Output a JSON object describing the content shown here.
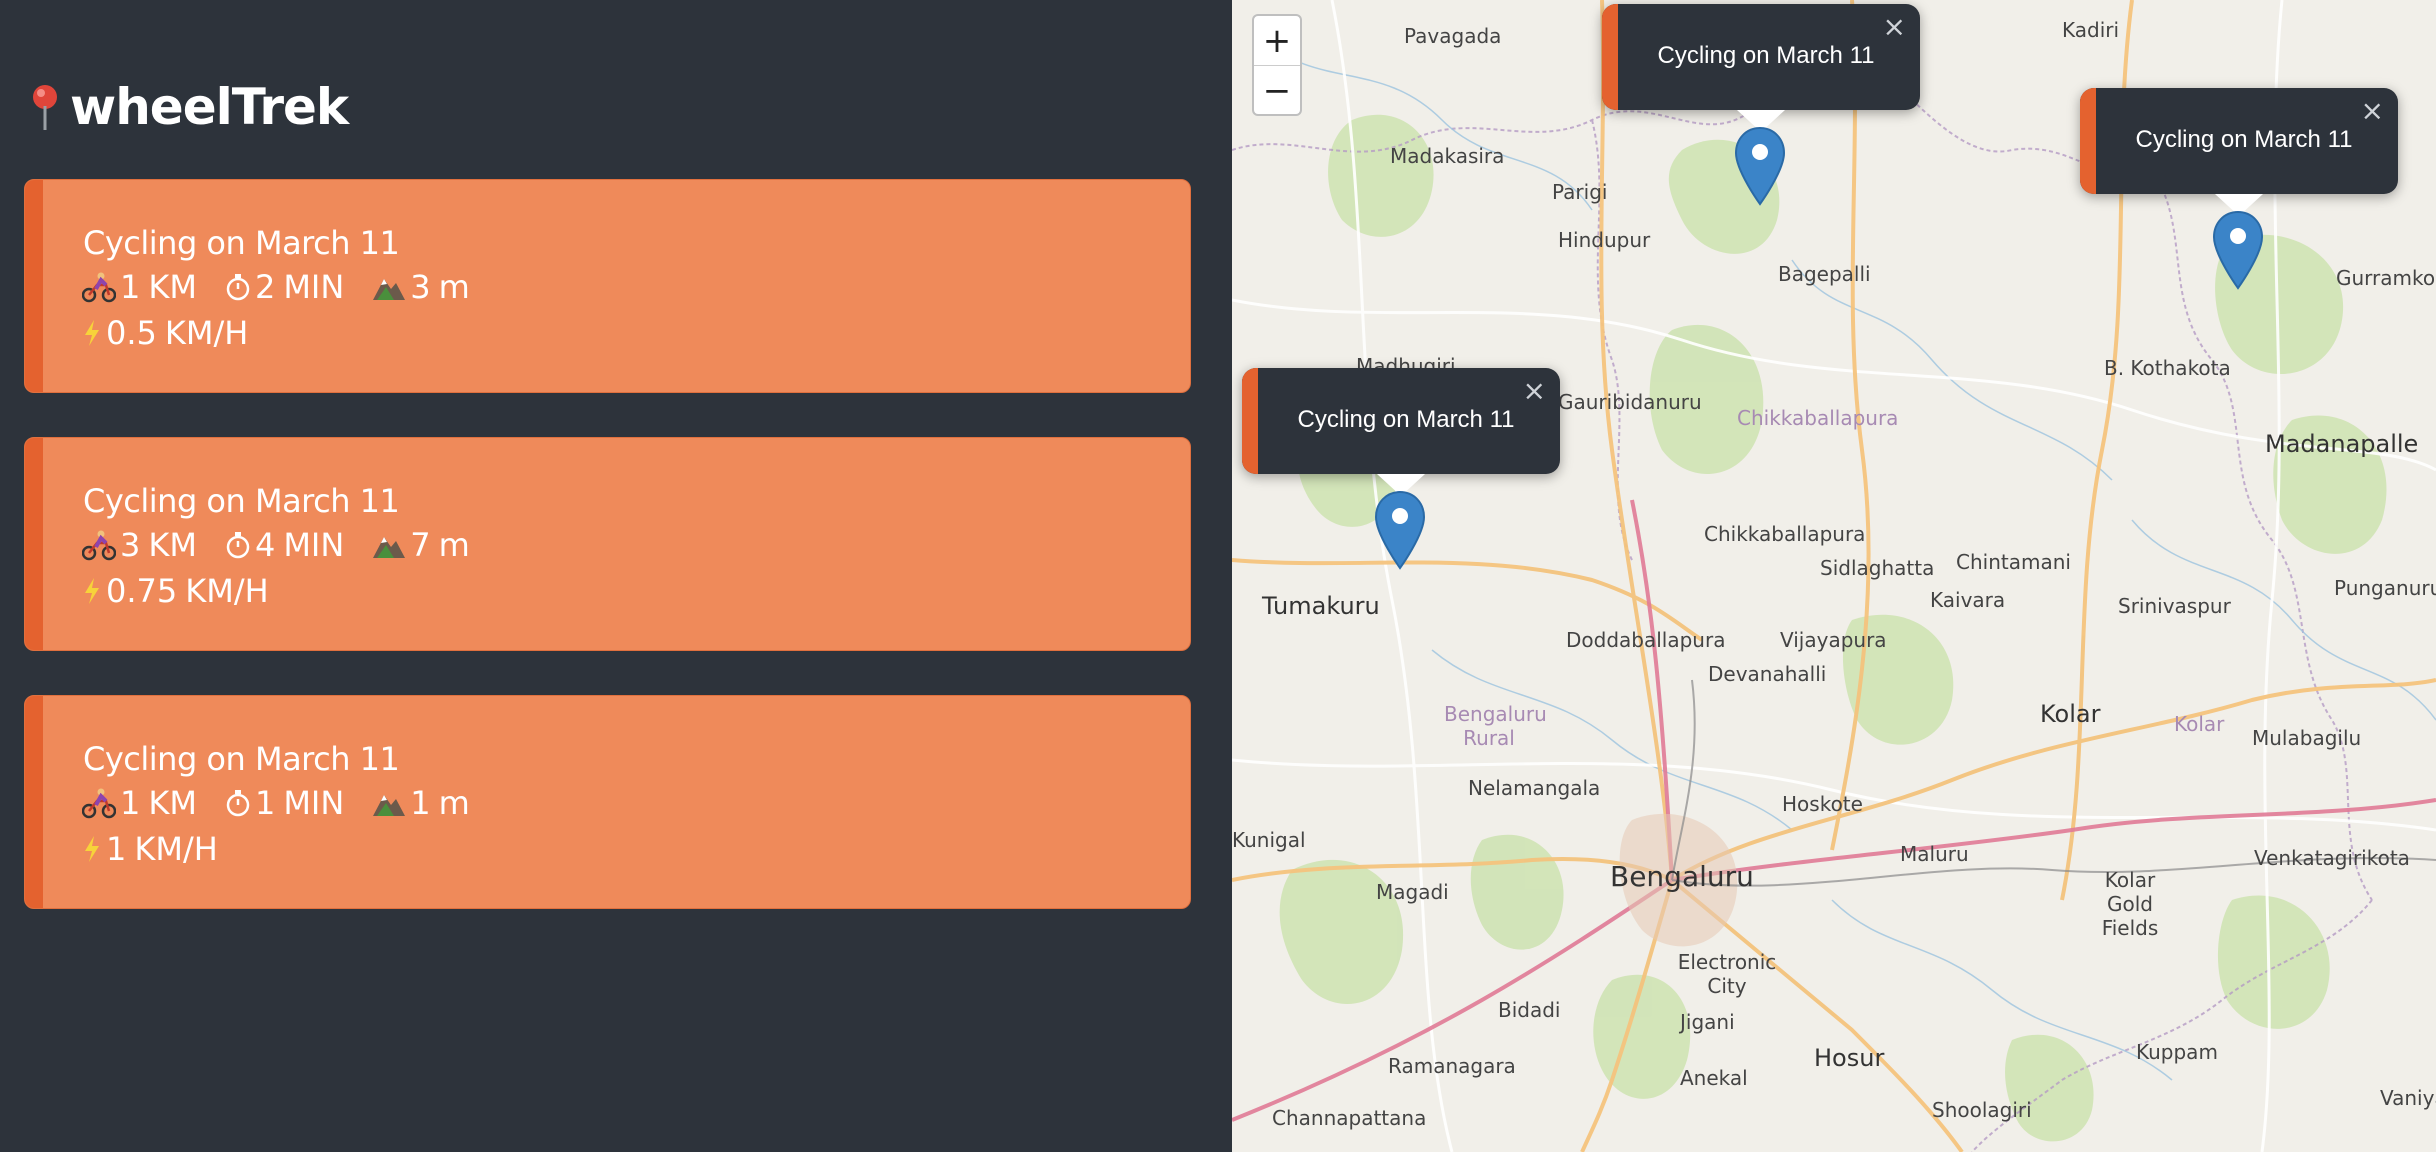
{
  "app": {
    "name": "wheelTrek"
  },
  "workouts": [
    {
      "title": "Cycling on March 11",
      "distance": "1",
      "distance_unit": "KM",
      "duration": "2",
      "duration_unit": "MIN",
      "elevation": "3",
      "elevation_unit": "m",
      "speed": "0.5",
      "speed_unit": "KM/H"
    },
    {
      "title": "Cycling on March 11",
      "distance": "3",
      "distance_unit": "KM",
      "duration": "4",
      "duration_unit": "MIN",
      "elevation": "7",
      "elevation_unit": "m",
      "speed": "0.75",
      "speed_unit": "KM/H"
    },
    {
      "title": "Cycling on March 11",
      "distance": "1",
      "distance_unit": "KM",
      "duration": "1",
      "duration_unit": "MIN",
      "elevation": "1",
      "elevation_unit": "m",
      "speed": "1",
      "speed_unit": "KM/H"
    }
  ],
  "icons": {
    "logo": "map-pin-icon",
    "distance": "cyclist-icon",
    "duration": "stopwatch-icon",
    "elevation": "mountain-icon",
    "speed": "lightning-icon"
  },
  "map": {
    "zoom_in": "+",
    "zoom_out": "−",
    "popups": [
      {
        "text": "Cycling on March 11",
        "close": "×"
      },
      {
        "text": "Cycling on March 11",
        "close": "×"
      },
      {
        "text": "Cycling on March 11",
        "close": "×"
      }
    ],
    "places": [
      "Pavagada",
      "Kadiri",
      "Madakasira",
      "Parigi",
      "Hindupur",
      "Bagepalli",
      "Gurramkonda",
      "B. Kothakota",
      "Madhugiri",
      "Gauribidanuru",
      "Chikkaballapura",
      "Madanapalle",
      "Chikkaballapura",
      "Sidlaghatta",
      "Chintamani",
      "Kaivara",
      "Srinivaspur",
      "Punganuru",
      "Tumakuru",
      "Doddaballapura",
      "Vijayapura",
      "Devanahalli",
      "Bengaluru Rural",
      "Kolar",
      "Kolar",
      "Mulabagilu",
      "Kunigal",
      "Nelamangala",
      "Hoskote",
      "Maluru",
      "Venkatagirikota",
      "Magadi",
      "Bengaluru",
      "Kolar Gold Fields",
      "Electronic City",
      "Bidadi",
      "Jigani",
      "Ramanagara",
      "Anekal",
      "Hosur",
      "Kuppam",
      "Channapattana",
      "Shoolagiri",
      "Vaniyam"
    ],
    "colors": {
      "accent": "#e4622f",
      "card": "#ef8a5a",
      "panel": "#2d333b",
      "marker": "#3b84c8"
    }
  }
}
